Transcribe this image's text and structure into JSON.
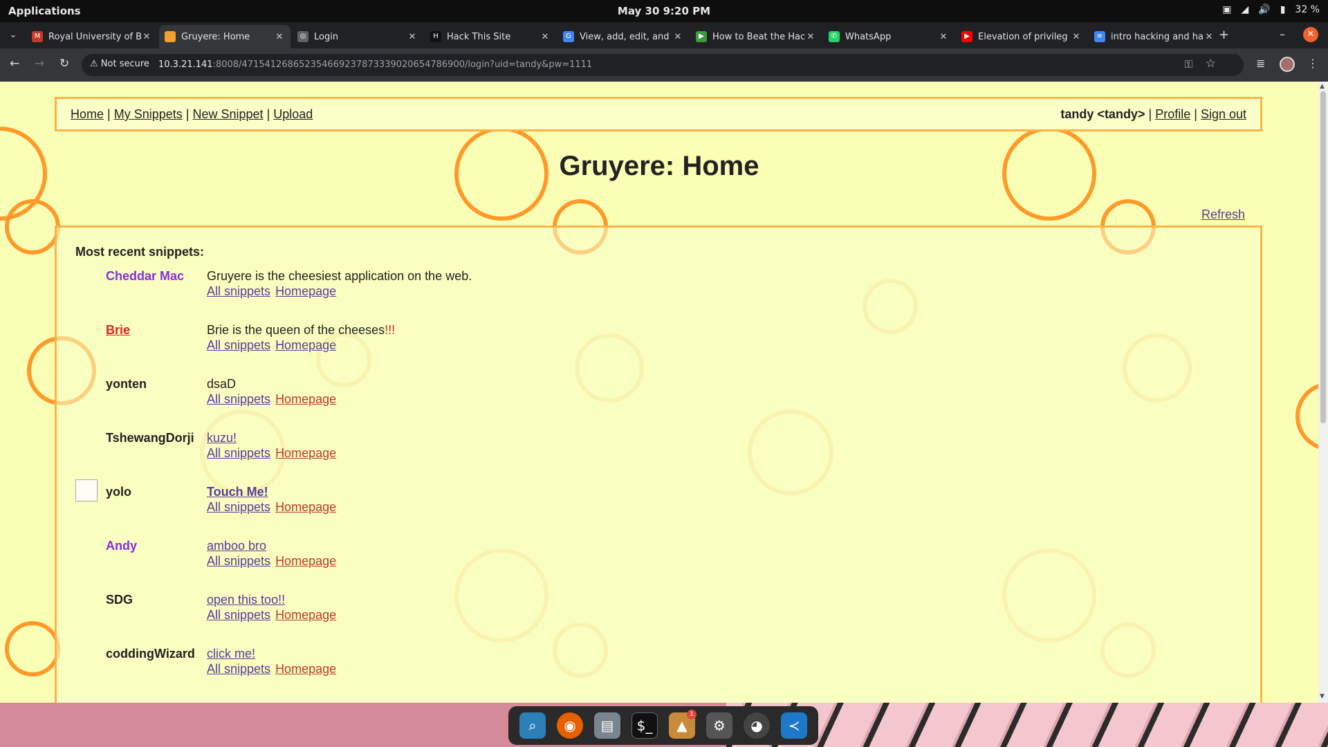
{
  "system_bar": {
    "apps_label": "Applications",
    "clock": "May 30   9:20 PM",
    "battery": "32 %"
  },
  "tabs": [
    {
      "title": "Royal University of B",
      "favicon_color": "#c53929",
      "favicon_glyph": "M"
    },
    {
      "title": "Gruyere: Home",
      "favicon_color": "#f0a030",
      "favicon_glyph": ""
    },
    {
      "title": "Login",
      "favicon_color": "#5f6368",
      "favicon_glyph": "◎"
    },
    {
      "title": "Hack This Site",
      "favicon_color": "#111111",
      "favicon_glyph": "H"
    },
    {
      "title": "View, add, edit, and",
      "favicon_color": "#4285f4",
      "favicon_glyph": "G"
    },
    {
      "title": "How to Beat the Hac",
      "favicon_color": "#3a9d3a",
      "favicon_glyph": "▶"
    },
    {
      "title": "WhatsApp",
      "favicon_color": "#25d366",
      "favicon_glyph": "✆"
    },
    {
      "title": "Elevation of privileg",
      "favicon_color": "#ff0000",
      "favicon_glyph": "▶"
    },
    {
      "title": "intro hacking and ha",
      "favicon_color": "#4285f4",
      "favicon_glyph": "≡"
    }
  ],
  "address_bar": {
    "security": "Not secure",
    "url_host": "10.3.21.141",
    "url_rest": ":8008/471541268652354669237873339020654786900/login?uid=tandy&pw=1111"
  },
  "menu": {
    "home": "Home",
    "sep1": "|",
    "my_snippets": "My Snippets",
    "sep2": "|",
    "new_snippet": "New Snippet",
    "sep3": "|",
    "upload": "Upload",
    "user": "tandy <tandy>",
    "sep4": "|",
    "profile": "Profile",
    "sep5": "|",
    "sign_out": "Sign out"
  },
  "page_title": "Gruyere: Home",
  "refresh": "Refresh",
  "recent_heading": "Most recent snippets:",
  "snippets": [
    {
      "author": "Cheddar Mac",
      "body": "Gruyere is the cheesiest application on the web.",
      "body_extra": "",
      "all": "All snippets",
      "home": "Homepage"
    },
    {
      "author": "Brie",
      "body": "Brie is the queen of the cheeses",
      "body_extra": "!!!",
      "all": "All snippets",
      "home": "Homepage"
    },
    {
      "author": "yonten",
      "body": "dsaD",
      "body_extra": "",
      "all": "All snippets",
      "home": "Homepage"
    },
    {
      "author": "TshewangDorji",
      "body": "kuzu!",
      "body_extra": "",
      "all": "All snippets",
      "home": "Homepage"
    },
    {
      "author": "yolo",
      "body": "Touch Me!",
      "body_extra": "",
      "all": "All snippets",
      "home": "Homepage"
    },
    {
      "author": "Andy",
      "body": "amboo bro",
      "body_extra": "",
      "all": "All snippets",
      "home": "Homepage"
    },
    {
      "author": "SDG",
      "body": "open this too!!",
      "body_extra": "",
      "all": "All snippets",
      "home": "Homepage"
    },
    {
      "author": "coddingWizard",
      "body": "click me!",
      "body_extra": "",
      "all": "All snippets",
      "home": "Homepage"
    }
  ],
  "colors": {
    "page_bg": "#f9ffb5",
    "accent_orange": "#ff9a2a",
    "link_purple": "#5a3b9c",
    "author_purple": "#8a2be2",
    "author_red": "#e02020"
  }
}
